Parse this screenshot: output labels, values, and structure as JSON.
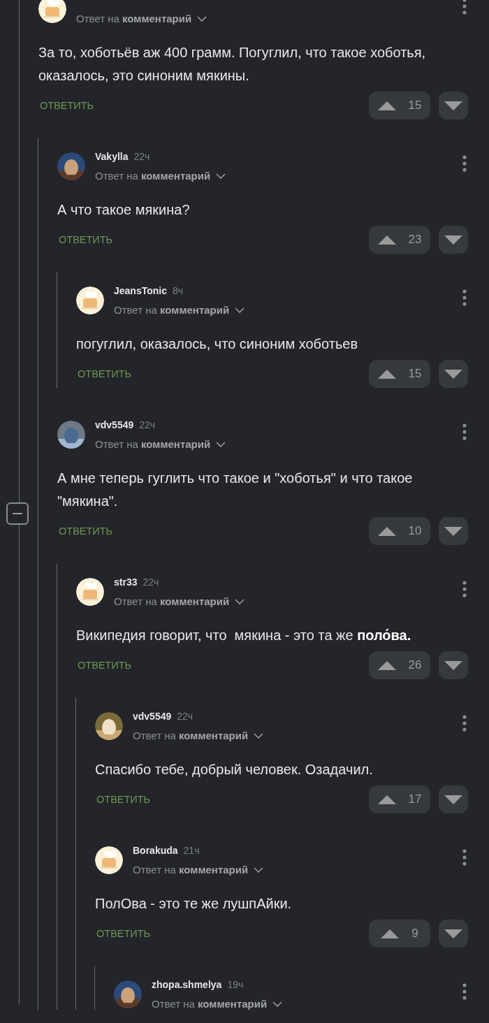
{
  "comments": [
    {
      "author": {
        "default_avatar": true
      },
      "reply_to": "Ответ на **комментарий**",
      "text": "За то, хоботьёв аж 400 грамм. Погуглил, что такое хоботья, оказалось, это синоним мякины.",
      "reply_label": "ОТВЕТИТЬ",
      "votes": "15",
      "children": [
        {
          "author": {
            "name": "Vakylla",
            "time": "22ч",
            "default_avatar": false
          },
          "reply_to": "Ответ на **комментарий**",
          "text": "А что такое мякина?",
          "reply_label": "ОТВЕТИТЬ",
          "votes": "23",
          "children": [
            {
              "author": {
                "name": "JeansTonic",
                "time": "8ч",
                "default_avatar": true
              },
              "reply_to": "Ответ на **комментарий**",
              "text": "погуглил, оказалось, что синоним хоботьев",
              "reply_label": "ОТВЕТИТЬ",
              "votes": "15"
            }
          ]
        },
        {
          "author": {
            "name": "vdv5549",
            "time": "22ч",
            "default_avatar": false
          },
          "reply_to": "Ответ на **комментарий**",
          "text": "А мне теперь гуглить что такое и \"хоботья\" и что такое \"мякина\".",
          "reply_label": "ОТВЕТИТЬ",
          "votes": "10",
          "collapse_button": true,
          "children": [
            {
              "author": {
                "name": "str33",
                "time": "22ч",
                "default_avatar": true
              },
              "reply_to": "Ответ на **комментарий**",
              "text": "Википедия говорит, что  мякина - это та же **поло́ва.**",
              "reply_label": "ОТВЕТИТЬ",
              "votes": "26",
              "children": [
                {
                  "author": {
                    "name": "vdv5549",
                    "time": "22ч",
                    "default_avatar": false
                  },
                  "reply_to": "Ответ на **комментарий**",
                  "text": "Спасибо тебе, добрый человек. Озадачил.",
                  "reply_label": "ОТВЕТИТЬ",
                  "votes": "17"
                },
                {
                  "author": {
                    "name": "Borakuda",
                    "time": "21ч",
                    "default_avatar": true
                  },
                  "reply_to": "Ответ на **комментарий**",
                  "text": "ПолОва - это те же лушпАйки.",
                  "reply_label": "ОТВЕТИТЬ",
                  "votes": "9",
                  "children": [
                    {
                      "author": {
                        "name": "zhopa.shmelya",
                        "time": "19ч",
                        "default_avatar": false
                      },
                      "reply_to": "Ответ на **комментарий**"
                    }
                  ]
                }
              ]
            }
          ]
        }
      ]
    }
  ]
}
